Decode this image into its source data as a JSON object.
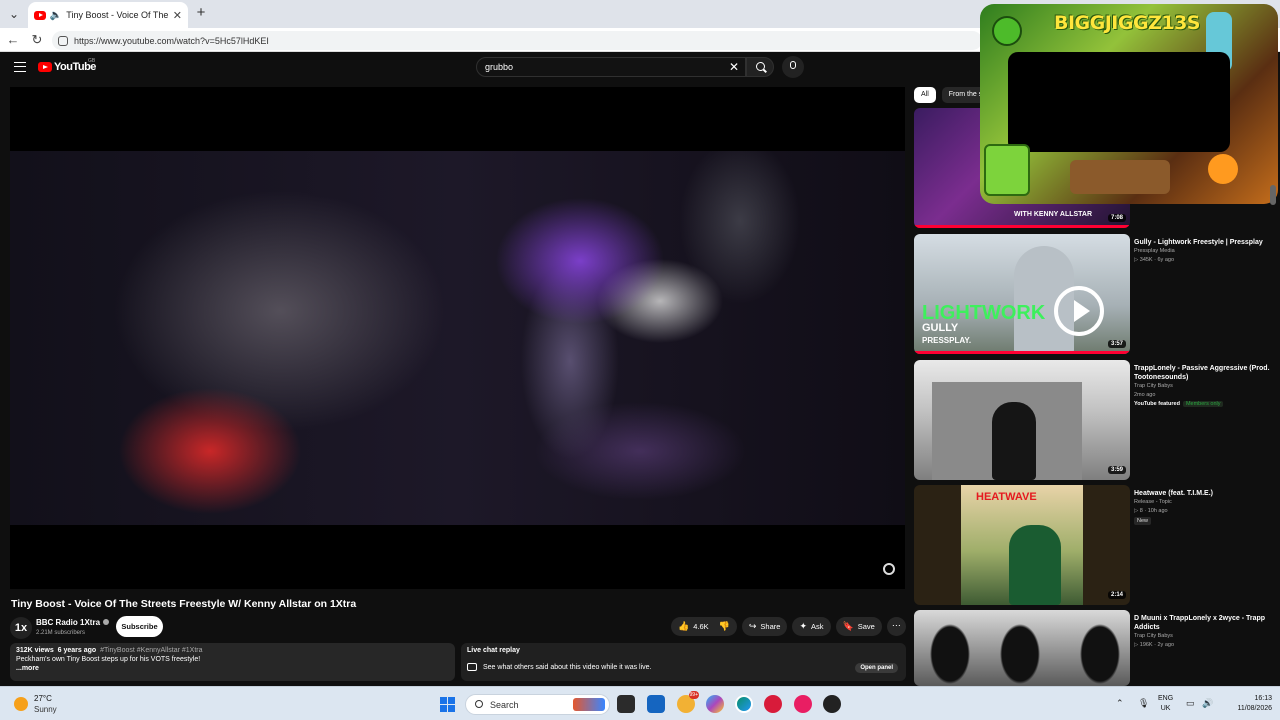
{
  "browser": {
    "tab_title": "Tiny Boost - Voice Of The Stre",
    "url": "https://www.youtube.com/watch?v=5Hc57lHdKEI"
  },
  "youtube": {
    "logo_text": "YouTube",
    "country_code": "GB",
    "search_value": "grubbo",
    "video": {
      "title": "Tiny Boost - Voice Of The Streets Freestyle W/ Kenny Allstar on 1Xtra",
      "channel_avatar": "1x",
      "channel_name": "BBC Radio 1Xtra",
      "subscribers": "2.21M subscribers",
      "subscribe_label": "Subscribe",
      "likes": "4.6K",
      "share_label": "Share",
      "ask_label": "Ask",
      "save_label": "Save",
      "views": "312K views",
      "age": "6 years ago",
      "tags": "#TinyBoost #KennyAllstar #1Xtra",
      "description": "Peckham's own Tiny Boost steps up for his VOTS freestyle!",
      "more_label": "...more"
    },
    "live_chat": {
      "title": "Live chat replay",
      "text": "See what others said about this video while it was live.",
      "open_label": "Open panel"
    },
    "chips": [
      "All",
      "From the se"
    ],
    "recommendations": [
      {
        "caption": "WITH KENNY ALLSTAR",
        "duration": "7:08"
      },
      {
        "title": "Gully - Lightwork Freestyle | Pressplay",
        "channel": "Pressplay Media",
        "meta": "▷ 345K · 6y ago",
        "duration": "3:57",
        "thumb_word": "LIGHTWORK",
        "thumb_sub": "GULLY",
        "thumb_sub2": "PRESSPLAY."
      },
      {
        "title": "TrappLonely - Passive Aggressive (Prod. Tootonesounds)",
        "channel": "Trap City Babys",
        "meta": "2mo ago",
        "badge_featured": "YouTube featured",
        "badge_members": "Members only",
        "duration": "3:59"
      },
      {
        "title": "Heatwave (feat. T.I.M.E.)",
        "channel": "Release - Topic",
        "meta": "▷ 8 · 10h ago",
        "badge_new": "New",
        "duration": "2:14",
        "cover_text": "HEATWAVE"
      },
      {
        "title": "D Muuni x TrappLonely x 2wyce - Trapp Addicts",
        "channel": "Trap City Babys",
        "meta": "▷ 196K · 2y ago"
      }
    ]
  },
  "overlay": {
    "name": "BIGGJIGGZ13S"
  },
  "taskbar": {
    "weather_temp": "27°C",
    "weather_desc": "Sunny",
    "search_label": "Search",
    "badge_count": "99+",
    "lang_line1": "ENG",
    "lang_line2": "UK",
    "time": "16:13",
    "date": "11/08/2026"
  }
}
